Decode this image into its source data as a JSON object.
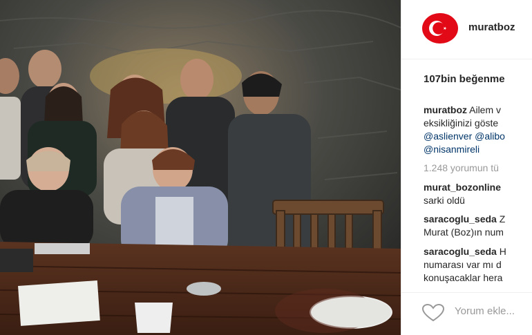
{
  "post": {
    "username": "muratboz",
    "likes": "107bin beğenme",
    "caption": {
      "user": "muratboz",
      "line1": "Ailem v",
      "line2": "eksikliğinizi göste",
      "mentions_line1": "@aslienver @alibo",
      "mentions_line2": "@nisanmireli"
    },
    "view_comments": "1.248 yorumun tü",
    "comments": [
      {
        "user": "murat_bozonline",
        "text": "sarki oldü"
      },
      {
        "user": "saracoglu_seda",
        "user_suffix": "Z",
        "text": "Murat (Boz)ın num"
      },
      {
        "user": "saracoglu_seda",
        "user_suffix": "H",
        "text": "numarası var mı d",
        "text2": "konuşacaklar hera"
      }
    ],
    "add_comment_placeholder": "Yorum ekle..."
  },
  "colors": {
    "avatar_red": "#e30a17",
    "text": "#262626",
    "muted": "#999999",
    "mention": "#003569"
  },
  "icons": [
    "turkish-flag-avatar",
    "heart-icon"
  ]
}
